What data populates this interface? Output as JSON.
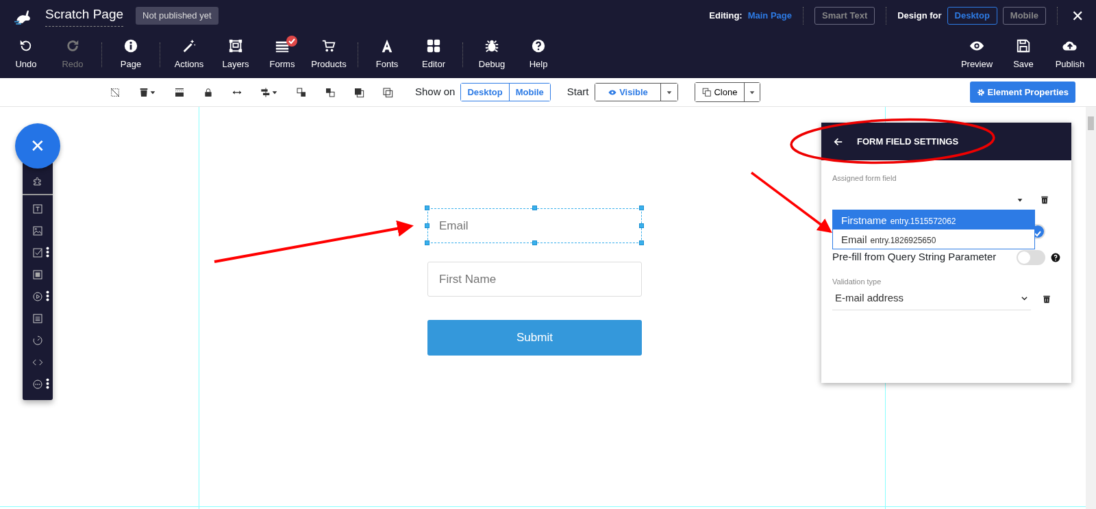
{
  "header": {
    "title": "Scratch Page",
    "status_badge": "Not published yet",
    "editing_label": "Editing:",
    "editing_page": "Main Page",
    "smart_text": {
      "label": "Smart Text",
      "disabled": true
    },
    "design_for_label": "Design for",
    "design_for": [
      {
        "label": "Desktop",
        "selected": true
      },
      {
        "label": "Mobile",
        "selected": false
      }
    ],
    "close": "✕"
  },
  "main_toolbar": {
    "groups": [
      [
        {
          "label": "Undo",
          "disabled": false
        },
        {
          "label": "Redo",
          "disabled": true
        }
      ],
      [
        {
          "label": "Page",
          "disabled": false
        }
      ],
      [
        {
          "label": "Actions",
          "disabled": false
        },
        {
          "label": "Layers",
          "disabled": false
        },
        {
          "label": "Forms",
          "disabled": false
        },
        {
          "label": "Products",
          "disabled": false
        }
      ],
      [
        {
          "label": "Fonts",
          "disabled": false
        },
        {
          "label": "Editor",
          "disabled": false
        }
      ],
      [
        {
          "label": "Debug",
          "disabled": false
        },
        {
          "label": "Help",
          "disabled": false
        }
      ]
    ],
    "right": [
      {
        "label": "Preview"
      },
      {
        "label": "Save"
      },
      {
        "label": "Publish"
      }
    ]
  },
  "element_toolbar": {
    "show_on_label": "Show on",
    "show_on": [
      {
        "label": "Desktop"
      },
      {
        "label": "Mobile"
      }
    ],
    "start_label": "Start",
    "visibility": "Visible",
    "clone": "Clone",
    "properties": "Element Properties"
  },
  "canvas": {
    "fields": [
      {
        "placeholder": "Email",
        "selected": true
      },
      {
        "placeholder": "First Name",
        "selected": false
      }
    ],
    "submit": "Submit"
  },
  "settings_panel": {
    "title": "FORM FIELD SETTINGS",
    "assigned_label": "Assigned form field",
    "dropdown_options": [
      {
        "name": "Firstname",
        "entry": "entry.1515572062",
        "selected": true
      },
      {
        "name": "Email",
        "entry": "entry.1826925650",
        "selected": false
      }
    ],
    "toggles": [
      {
        "on": true
      },
      {
        "label": "Pre-fill from Query String Parameter",
        "on": false
      }
    ],
    "validation_label": "Validation type",
    "validation_value": "E-mail address"
  }
}
